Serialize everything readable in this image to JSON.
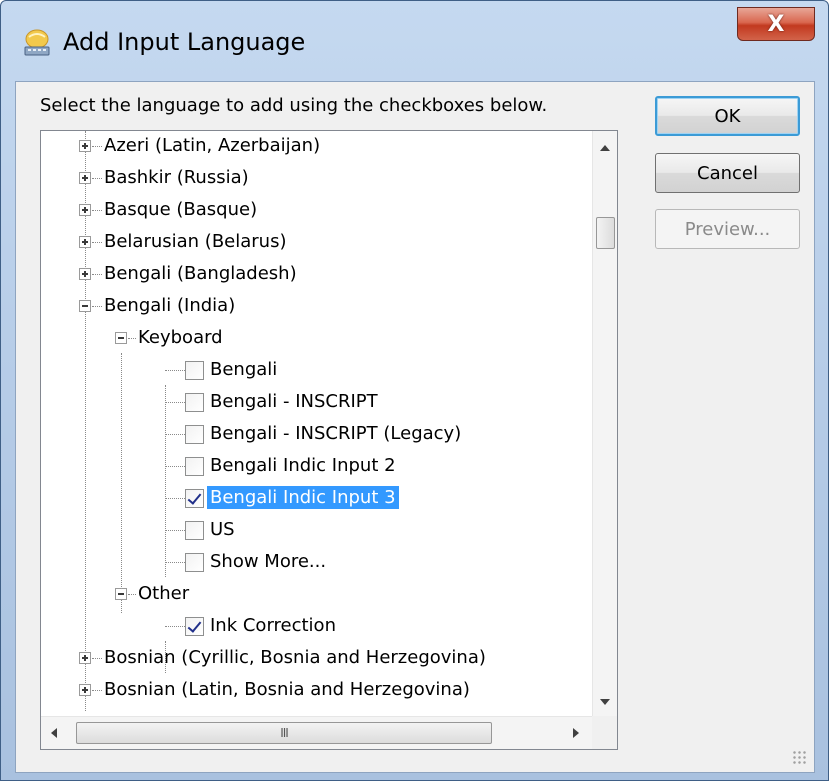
{
  "window": {
    "title": "Add Input Language",
    "close_label": "X"
  },
  "instruction": "Select the language to add using the checkboxes below.",
  "buttons": {
    "ok": "OK",
    "cancel": "Cancel",
    "preview": "Preview..."
  },
  "tree": {
    "languages_before": [
      {
        "label": "Azeri (Latin, Azerbaijan)",
        "expanded": false
      },
      {
        "label": "Bashkir (Russia)",
        "expanded": false
      },
      {
        "label": "Basque (Basque)",
        "expanded": false
      },
      {
        "label": "Belarusian (Belarus)",
        "expanded": false
      },
      {
        "label": "Bengali (Bangladesh)",
        "expanded": false
      },
      {
        "label": "Bengali (India)",
        "expanded": true
      }
    ],
    "keyboard_group": "Keyboard",
    "keyboards": [
      {
        "label": "Bengali",
        "checked": false
      },
      {
        "label": "Bengali - INSCRIPT",
        "checked": false
      },
      {
        "label": "Bengali - INSCRIPT (Legacy)",
        "checked": false
      },
      {
        "label": "Bengali Indic Input 2",
        "checked": false
      },
      {
        "label": "Bengali Indic Input 3",
        "checked": true,
        "selected": true
      },
      {
        "label": "US",
        "checked": false
      },
      {
        "label": "Show More...",
        "checked": false
      }
    ],
    "other_group": "Other",
    "other_items": [
      {
        "label": "Ink Correction",
        "checked": true
      }
    ],
    "languages_after": [
      {
        "label": "Bosnian (Cyrillic, Bosnia and Herzegovina)",
        "expanded": false
      },
      {
        "label": "Bosnian (Latin, Bosnia and Herzegovina)",
        "expanded": false
      }
    ]
  },
  "hscroll_grip": "III",
  "colors": {
    "selection": "#3399ff",
    "client_bg": "#f0f0f0",
    "title_gradient": "#c5d9f0",
    "close_red": "#c2391f"
  }
}
